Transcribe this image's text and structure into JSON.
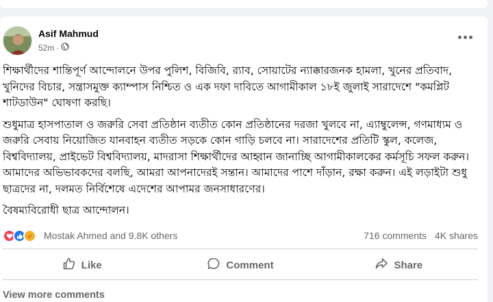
{
  "post": {
    "author": "Asif Mahmud",
    "time": "52m",
    "paragraphs": [
      "শিক্ষার্থীদের শান্তিপূর্ণ আন্দোলনে উপর পুলিশ, বিজিবি, র‍্যাব, সোয়াটের ন্যাক্কারজনক হামলা, খুনের প্রতিবাদ, খুনিদের বিচার, সন্ত্রাসমুক্ত ক্যাম্পাস নিশ্চিত ও এক দফা দাবিতে আগামীকাল ১৮ই জুলাই সারাদেশে \"কমপ্লিট শাটডাউন\" ঘোষণা করছি।",
      "শুধুমাত্র হাসপাতাল ও জরুরি সেবা প্রতিষ্ঠান ব্যতীত কোন প্রতিষ্ঠানের দরজা খুলবে না, এ্যাম্বুলেন্স, গণমাধ্যম ও জরুরি সেবায় নিয়োজিত যানবাহন ব্যতীত সড়কে কোন গাড়ি চলবে না। সারাদেশের প্রতিটি স্কুল, কলেজ, বিশ্ববিদ্যালয়, প্রাইভেট বিশ্ববিদ্যালয়, মাদরাসা শিক্ষার্থীদের আহ্বান জানাচ্ছি আগামীকালকের কর্মসূচি সফল করুন।",
      "আমাদের অভিভাবকদের বলছি, আমরা আপনাদেরই সন্তান। আমাদের পাশে দাঁড়ান, রক্ষা করুন। এই লড়াইটা শুধু ছাত্রদের না, দলমত নির্বিশেষে এদেশের আপামর জনসাধারণের।",
      "বৈষম্যবিরোধী ছাত্র আন্দোলন।"
    ]
  },
  "stats": {
    "reactors": "Mostak Ahmed and 9.8K others",
    "comments": "716 comments",
    "shares": "4K shares"
  },
  "actions": {
    "like": "Like",
    "comment": "Comment",
    "share": "Share"
  },
  "footer": {
    "view_more": "View more comments"
  },
  "colors": {
    "love": "#f33e58",
    "like": "#1877f2",
    "care": "#f7b125",
    "muted": "#65676b"
  },
  "icons": [
    "globe-icon",
    "more-options-icon",
    "love-reaction-icon",
    "like-reaction-icon",
    "care-reaction-icon",
    "like-icon",
    "comment-icon",
    "share-icon"
  ]
}
